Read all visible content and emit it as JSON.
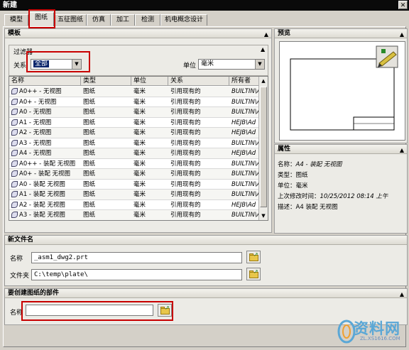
{
  "window": {
    "title": "新建",
    "close_glyph": "✕"
  },
  "tabs": [
    {
      "label": "模型"
    },
    {
      "label": "图纸"
    },
    {
      "label": "五征图纸"
    },
    {
      "label": "仿真"
    },
    {
      "label": "加工"
    },
    {
      "label": "检测"
    },
    {
      "label": "机电概念设计"
    }
  ],
  "templates_panel": {
    "title": "模板",
    "filter": {
      "title": "过滤器",
      "relation_label": "关系",
      "relation_value": "全部",
      "unit_label": "单位",
      "unit_value": "毫米"
    },
    "columns": [
      "名称",
      "类型",
      "单位",
      "关系",
      "所有者"
    ],
    "rows": [
      [
        "A0++ - 无视图",
        "图纸",
        "毫米",
        "引用现有的",
        "BUILTIN\\A"
      ],
      [
        "A0+ - 无视图",
        "图纸",
        "毫米",
        "引用现有的",
        "BUILTIN\\A"
      ],
      [
        "A0 - 无视图",
        "图纸",
        "毫米",
        "引用现有的",
        "BUILTIN\\A"
      ],
      [
        "A1 - 无视图",
        "图纸",
        "毫米",
        "引用现有的",
        "HEJB\\Ad"
      ],
      [
        "A2 - 无视图",
        "图纸",
        "毫米",
        "引用现有的",
        "HEJB\\Ad"
      ],
      [
        "A3 - 无视图",
        "图纸",
        "毫米",
        "引用现有的",
        "BUILTIN\\A"
      ],
      [
        "A4 - 无视图",
        "图纸",
        "毫米",
        "引用现有的",
        "HEJB\\Ad"
      ],
      [
        "A0++ - 装配 无视图",
        "图纸",
        "毫米",
        "引用现有的",
        "BUILTIN\\A"
      ],
      [
        "A0+ - 装配 无视图",
        "图纸",
        "毫米",
        "引用现有的",
        "BUILTIN\\A"
      ],
      [
        "A0 - 装配 无视图",
        "图纸",
        "毫米",
        "引用现有的",
        "BUILTIN\\A"
      ],
      [
        "A1 - 装配 无视图",
        "图纸",
        "毫米",
        "引用现有的",
        "BUILTIN\\A"
      ],
      [
        "A2 - 装配 无视图",
        "图纸",
        "毫米",
        "引用现有的",
        "HEJB\\Ad"
      ],
      [
        "A3 - 装配 无视图",
        "图纸",
        "毫米",
        "引用现有的",
        "BUILTIN\\A"
      ]
    ]
  },
  "preview_panel": {
    "title": "预览"
  },
  "properties_panel": {
    "title": "属性",
    "items": [
      {
        "key": "名称：",
        "value": "A4 - 装配 无视图"
      },
      {
        "key": "类型：",
        "value": "图纸"
      },
      {
        "key": "单位：",
        "value": "毫米"
      },
      {
        "key": "上次修改时间：",
        "value": "10/25/2012 08:14 上午"
      },
      {
        "key": "描述：",
        "value": "A4 装配 无视图"
      }
    ]
  },
  "new_file_panel": {
    "title": "新文件名",
    "name_label": "名称",
    "name_value": "_asm1_dwg2.prt",
    "folder_label": "文件夹",
    "folder_value": "C:\\temp\\plate\\"
  },
  "part_panel": {
    "title": "要创建图纸的部件",
    "name_label": "名称",
    "name_value": ""
  },
  "watermark": {
    "text": "资料网",
    "url": "ZL.XS1616.COM"
  },
  "colors": {
    "highlight_red": "#c80000",
    "selection_blue": "#0a246a"
  }
}
